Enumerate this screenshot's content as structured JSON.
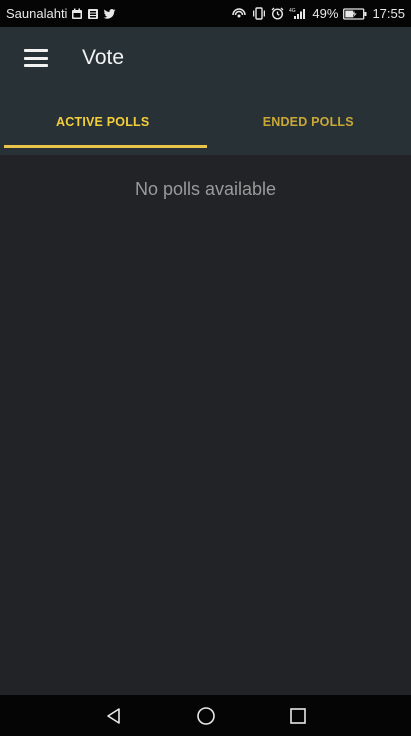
{
  "status_bar": {
    "carrier": "Saunalahti",
    "battery": "49%",
    "time": "17:55",
    "icons_left": [
      "calendar-icon",
      "news-icon",
      "twitter-icon"
    ],
    "icons_right": [
      "wifi-hotspot-icon",
      "vibrate-icon",
      "alarm-icon",
      "signal-4g-icon",
      "battery-charging-icon"
    ]
  },
  "toolbar": {
    "title": "Vote",
    "menu_icon": "hamburger-menu-icon"
  },
  "tabs": [
    {
      "label": "ACTIVE POLLS",
      "active": true
    },
    {
      "label": "ENDED POLLS",
      "active": false
    }
  ],
  "main": {
    "empty_message": "No polls available"
  },
  "nav_bar": {
    "buttons": [
      "back-icon",
      "home-icon",
      "recents-icon"
    ]
  },
  "colors": {
    "accent": "#f4cf3a",
    "header_bg": "#283136",
    "content_bg": "#222327",
    "system_bar_bg": "#050505"
  }
}
